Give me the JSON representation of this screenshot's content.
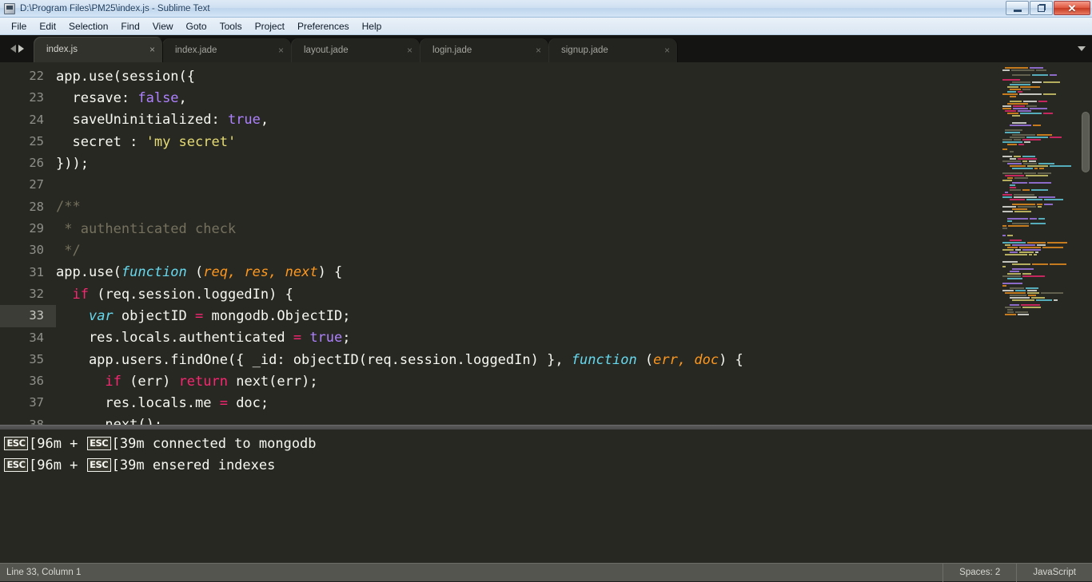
{
  "window": {
    "title": "D:\\Program Files\\PM25\\index.js - Sublime Text",
    "icon": "sublime-text-icon",
    "controls": {
      "minimize": "—",
      "maximize": "❐",
      "close": "✕"
    }
  },
  "menu": {
    "items": [
      {
        "label": "File"
      },
      {
        "label": "Edit"
      },
      {
        "label": "Selection"
      },
      {
        "label": "Find"
      },
      {
        "label": "View"
      },
      {
        "label": "Goto"
      },
      {
        "label": "Tools"
      },
      {
        "label": "Project"
      },
      {
        "label": "Preferences"
      },
      {
        "label": "Help"
      }
    ]
  },
  "tabs": {
    "close_glyph": "×",
    "items": [
      {
        "label": "index.js",
        "active": true
      },
      {
        "label": "index.jade",
        "active": false
      },
      {
        "label": "layout.jade",
        "active": false
      },
      {
        "label": "login.jade",
        "active": false
      },
      {
        "label": "signup.jade",
        "active": false
      }
    ]
  },
  "editor": {
    "current_line": 33,
    "lines": [
      {
        "n": "22",
        "tokens": [
          {
            "t": "app.use(session({",
            "c": "pln"
          }
        ]
      },
      {
        "n": "23",
        "tokens": [
          {
            "t": "  resave: ",
            "c": "pln"
          },
          {
            "t": "false",
            "c": "num"
          },
          {
            "t": ",",
            "c": "pln"
          }
        ]
      },
      {
        "n": "24",
        "tokens": [
          {
            "t": "  saveUninitialized: ",
            "c": "pln"
          },
          {
            "t": "true",
            "c": "num"
          },
          {
            "t": ",",
            "c": "pln"
          }
        ]
      },
      {
        "n": "25",
        "tokens": [
          {
            "t": "  secret : ",
            "c": "pln"
          },
          {
            "t": "'my secret'",
            "c": "str"
          }
        ]
      },
      {
        "n": "26",
        "tokens": [
          {
            "t": "}));",
            "c": "pln"
          }
        ]
      },
      {
        "n": "27",
        "tokens": [
          {
            "t": "",
            "c": "pln"
          }
        ]
      },
      {
        "n": "28",
        "tokens": [
          {
            "t": "/**",
            "c": "cmt"
          }
        ]
      },
      {
        "n": "29",
        "tokens": [
          {
            "t": " * authenticated check",
            "c": "cmt"
          }
        ]
      },
      {
        "n": "30",
        "tokens": [
          {
            "t": " */",
            "c": "cmt"
          }
        ]
      },
      {
        "n": "31",
        "tokens": [
          {
            "t": "app.use(",
            "c": "pln"
          },
          {
            "t": "function",
            "c": "fn"
          },
          {
            "t": " (",
            "c": "pln"
          },
          {
            "t": "req, res, next",
            "c": "par"
          },
          {
            "t": ") {",
            "c": "pln"
          }
        ]
      },
      {
        "n": "32",
        "tokens": [
          {
            "t": "  ",
            "c": "pln"
          },
          {
            "t": "if",
            "c": "kw"
          },
          {
            "t": " (req.session.loggedIn) {",
            "c": "pln"
          }
        ]
      },
      {
        "n": "33",
        "tokens": [
          {
            "t": "    ",
            "c": "pln"
          },
          {
            "t": "var",
            "c": "fn"
          },
          {
            "t": " objectID ",
            "c": "pln"
          },
          {
            "t": "=",
            "c": "kw"
          },
          {
            "t": " mongodb.ObjectID;",
            "c": "pln"
          }
        ]
      },
      {
        "n": "34",
        "tokens": [
          {
            "t": "    res.locals.authenticated ",
            "c": "pln"
          },
          {
            "t": "=",
            "c": "kw"
          },
          {
            "t": " ",
            "c": "pln"
          },
          {
            "t": "true",
            "c": "num"
          },
          {
            "t": ";",
            "c": "pln"
          }
        ]
      },
      {
        "n": "35",
        "tokens": [
          {
            "t": "    app.users.findOne({ _id: objectID(req.session.loggedIn) }, ",
            "c": "pln"
          },
          {
            "t": "function",
            "c": "fn"
          },
          {
            "t": " (",
            "c": "pln"
          },
          {
            "t": "err, doc",
            "c": "par"
          },
          {
            "t": ") {",
            "c": "pln"
          }
        ]
      },
      {
        "n": "36",
        "tokens": [
          {
            "t": "      ",
            "c": "pln"
          },
          {
            "t": "if",
            "c": "kw"
          },
          {
            "t": " (err) ",
            "c": "pln"
          },
          {
            "t": "return",
            "c": "kw"
          },
          {
            "t": " next(err);",
            "c": "pln"
          }
        ]
      },
      {
        "n": "37",
        "tokens": [
          {
            "t": "      res.locals.me ",
            "c": "pln"
          },
          {
            "t": "=",
            "c": "kw"
          },
          {
            "t": " doc;",
            "c": "pln"
          }
        ]
      },
      {
        "n": "38",
        "tokens": [
          {
            "t": "      next();",
            "c": "pln"
          }
        ]
      }
    ]
  },
  "console": {
    "lines": [
      {
        "parts": [
          {
            "esc": true
          },
          {
            "text": "[96m + "
          },
          {
            "esc": true
          },
          {
            "text": "[39m connected to mongodb"
          }
        ]
      },
      {
        "parts": [
          {
            "esc": true
          },
          {
            "text": "[96m + "
          },
          {
            "esc": true
          },
          {
            "text": "[39m ensered indexes"
          }
        ]
      }
    ],
    "esc_label": "ESC"
  },
  "statusbar": {
    "position": "Line 33, Column 1",
    "indent": "Spaces: 2",
    "syntax": "JavaScript"
  },
  "colors": {
    "editor_bg": "#272822",
    "plain": "#f8f8f2",
    "comment": "#75715e",
    "string": "#e6db74",
    "constant": "#ae81ff",
    "keyword": "#f92672",
    "function": "#66d9ef",
    "parameter": "#fd971f",
    "gutter": "#8f908a",
    "current_line_gutter": "#3c3d36",
    "statusbar_bg": "#555550",
    "tabbar_bg": "#141412"
  }
}
